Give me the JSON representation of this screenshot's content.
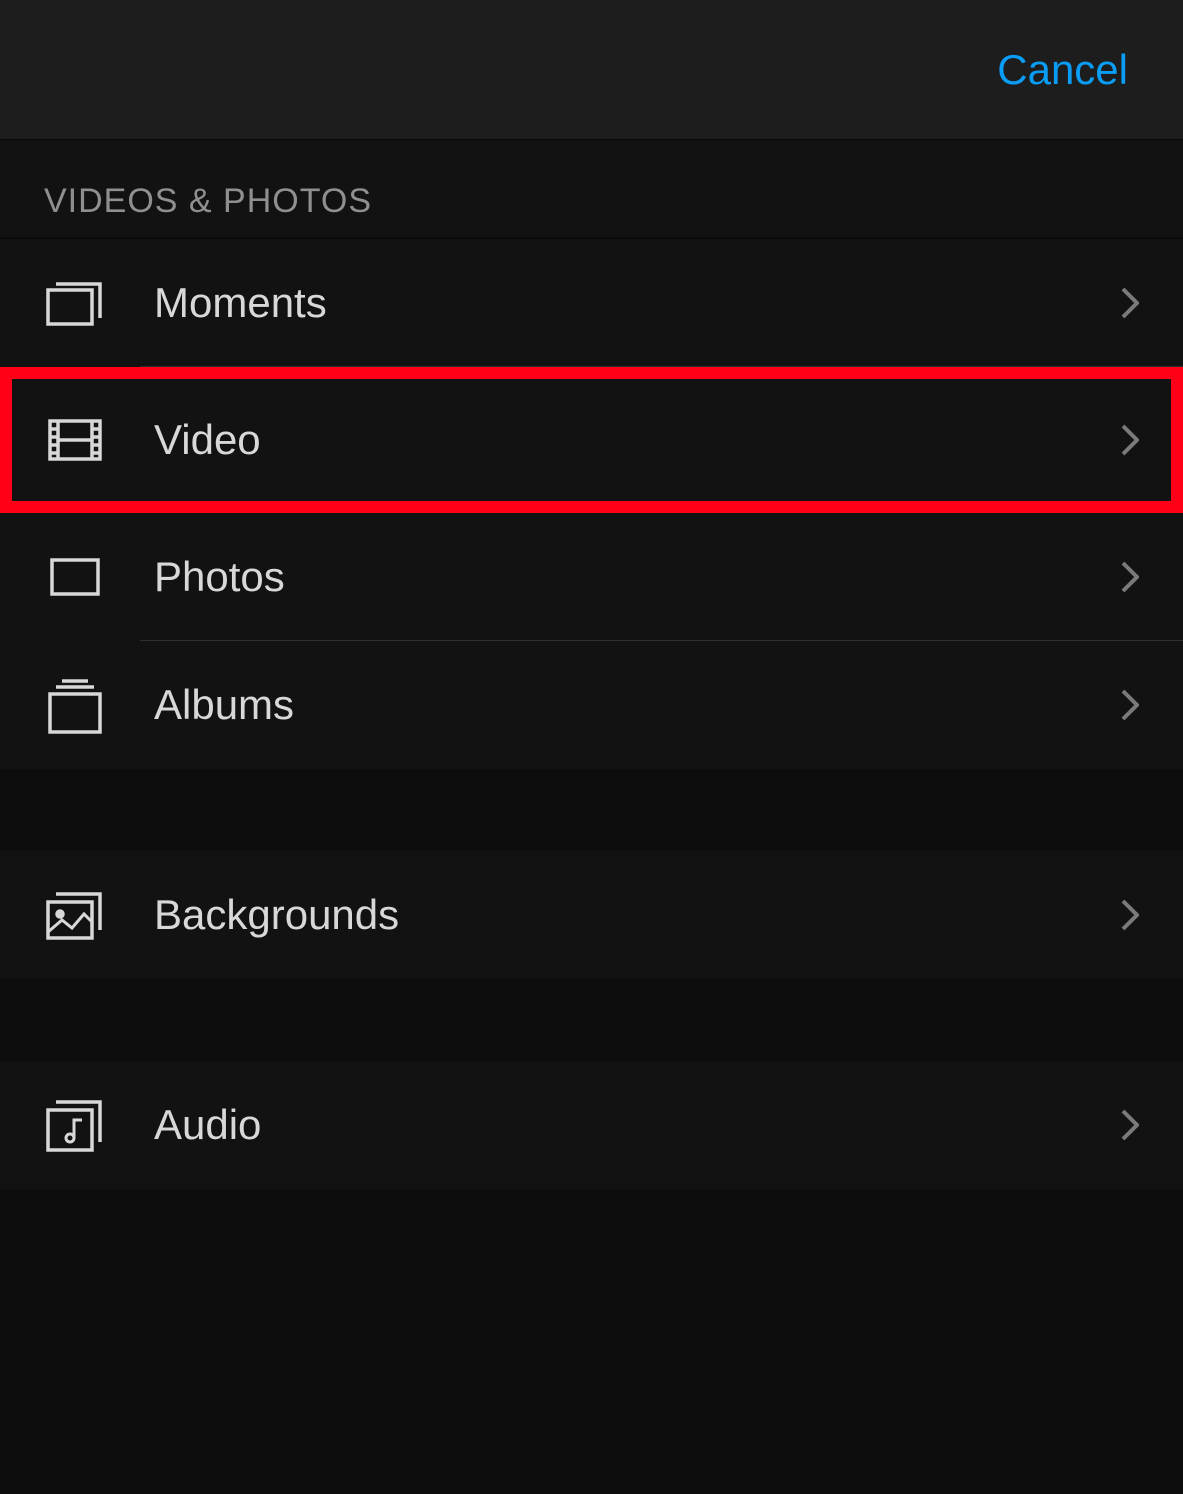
{
  "header": {
    "cancel_label": "Cancel"
  },
  "section1": {
    "header": "VIDEOS & PHOTOS",
    "items": [
      {
        "icon": "moments",
        "label": "Moments",
        "highlighted": false
      },
      {
        "icon": "video",
        "label": "Video",
        "highlighted": true
      },
      {
        "icon": "photos",
        "label": "Photos",
        "highlighted": false
      },
      {
        "icon": "albums",
        "label": "Albums",
        "highlighted": false
      }
    ]
  },
  "section2": {
    "items": [
      {
        "icon": "backgrounds",
        "label": "Backgrounds"
      }
    ]
  },
  "section3": {
    "items": [
      {
        "icon": "audio",
        "label": "Audio"
      }
    ]
  }
}
